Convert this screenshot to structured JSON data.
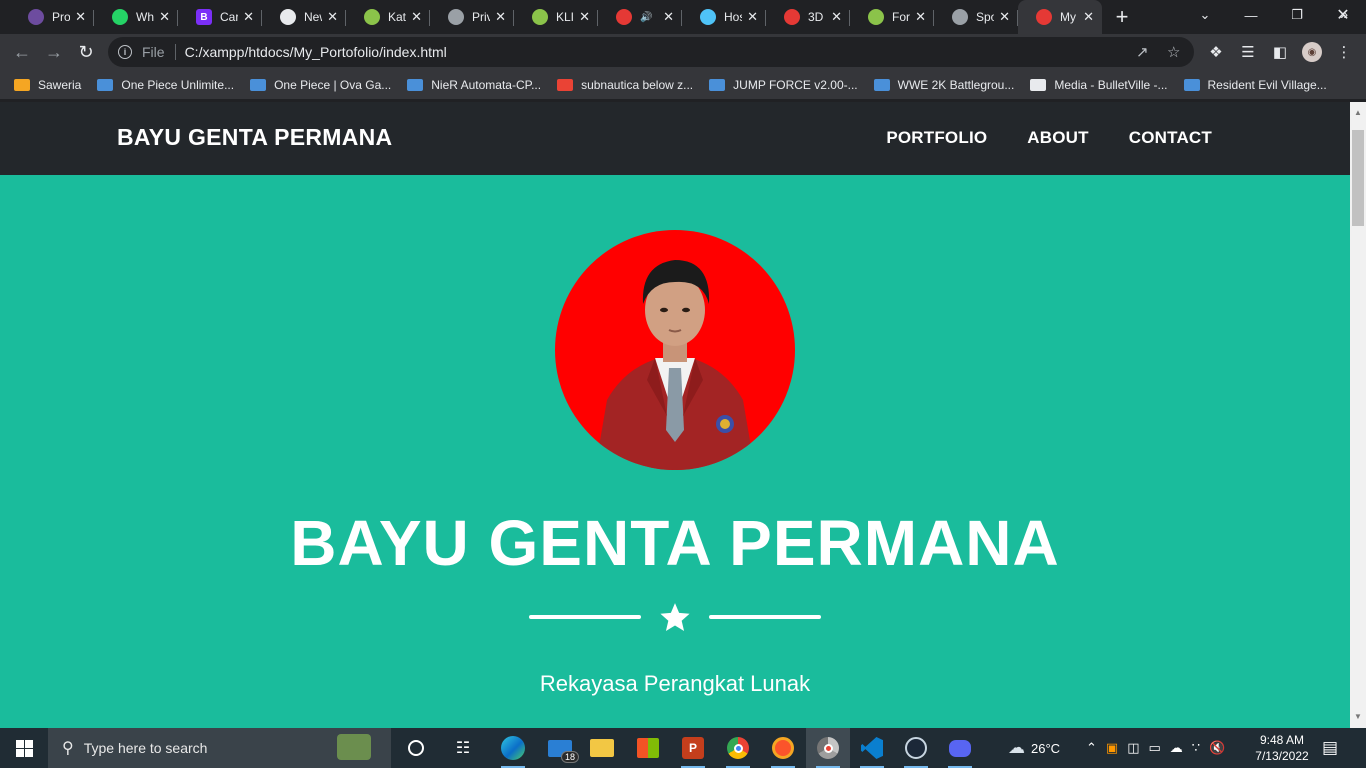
{
  "browser": {
    "tabs": [
      {
        "title": "Proj",
        "color": "#6d4c9f"
      },
      {
        "title": "Wha",
        "color": "#25d366"
      },
      {
        "title": "Car",
        "color": "#7b2ff7",
        "letter": "B"
      },
      {
        "title": "New",
        "color": "#e8eaed"
      },
      {
        "title": "Kata",
        "color": "#8bc34a"
      },
      {
        "title": "Priv",
        "color": "#9aa0a6"
      },
      {
        "title": "KLIK",
        "color": "#8bc34a"
      },
      {
        "title": "",
        "color": "#e53935",
        "audio": true
      },
      {
        "title": "Hos",
        "color": "#4fc3f7"
      },
      {
        "title": "3D",
        "color": "#e53935"
      },
      {
        "title": "Forr",
        "color": "#8bc34a"
      },
      {
        "title": "Spo",
        "color": "#9aa0a6"
      },
      {
        "title": "My",
        "color": "#e53935",
        "active": true
      }
    ],
    "address": {
      "scheme_label": "File",
      "url": "C:/xampp/htdocs/My_Portofolio/index.html"
    },
    "bookmarks": [
      {
        "label": "Saweria",
        "color": "#f5a623"
      },
      {
        "label": "One Piece Unlimite...",
        "color": "#4a90d9"
      },
      {
        "label": "One Piece | Ova Ga...",
        "color": "#4a90d9"
      },
      {
        "label": "NieR Automata-CP...",
        "color": "#4a90d9"
      },
      {
        "label": "subnautica below z...",
        "color": "#ea4335"
      },
      {
        "label": "JUMP FORCE v2.00-...",
        "color": "#4a90d9"
      },
      {
        "label": "WWE 2K Battlegrou...",
        "color": "#4a90d9"
      },
      {
        "label": "Media - BulletVille -...",
        "color": "#e8eaed"
      },
      {
        "label": "Resident Evil Village...",
        "color": "#4a90d9"
      }
    ]
  },
  "site": {
    "brand": "BAYU GENTA PERMANA",
    "nav": [
      "PORTFOLIO",
      "ABOUT",
      "CONTACT"
    ],
    "hero_title": "BAYU GENTA PERMANA",
    "subtitle": "Rekayasa Perangkat Lunak",
    "accent": "#1abc9c",
    "navbar_color": "#23272b",
    "avatar_bg": "#ff0000"
  },
  "taskbar": {
    "search_placeholder": "Type here to search",
    "mail_badge": "18",
    "weather": "26°C",
    "time": "9:48 AM",
    "date": "7/13/2022"
  }
}
